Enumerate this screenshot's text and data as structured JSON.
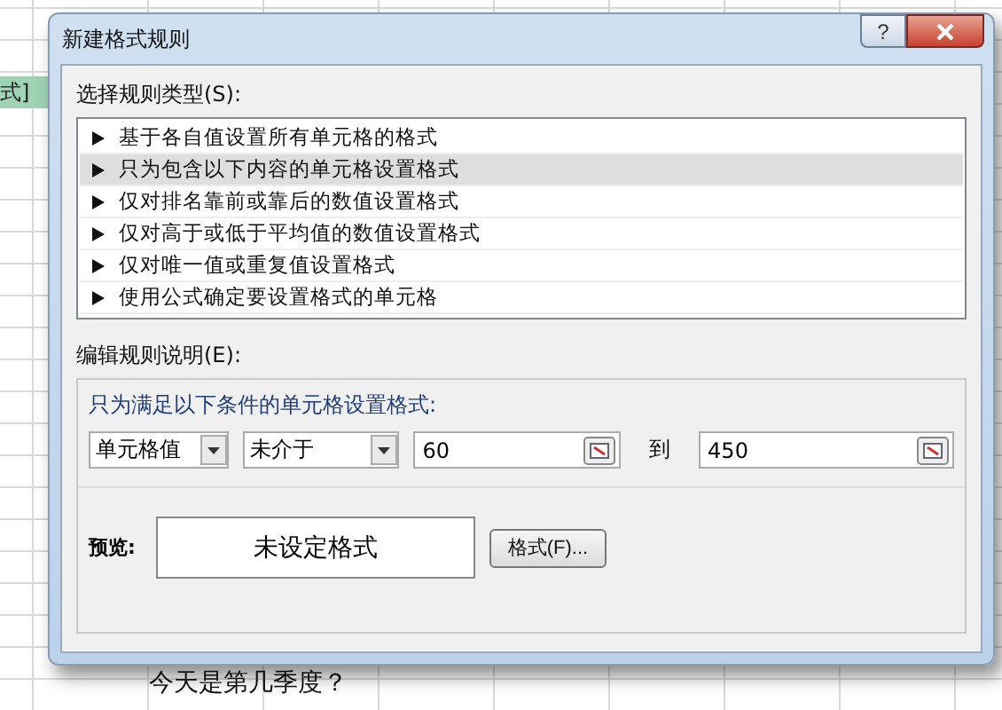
{
  "spreadsheet": {
    "cell_text": "式]",
    "bottom_text": "今天是第几季度？"
  },
  "dialog": {
    "title": "新建格式规则",
    "help_button": "?",
    "rule_type_label": "选择规则类型(S):",
    "rule_types": [
      {
        "label": "基于各自值设置所有单元格的格式",
        "selected": false
      },
      {
        "label": "只为包含以下内容的单元格设置格式",
        "selected": true
      },
      {
        "label": "仅对排名靠前或靠后的数值设置格式",
        "selected": false
      },
      {
        "label": "仅对高于或低于平均值的数值设置格式",
        "selected": false
      },
      {
        "label": "仅对唯一值或重复值设置格式",
        "selected": false
      },
      {
        "label": "使用公式确定要设置格式的单元格",
        "selected": false
      }
    ],
    "description_label": "编辑规则说明(E):",
    "condition_title": "只为满足以下条件的单元格设置格式:",
    "field_dropdown": "单元格值",
    "operator_dropdown": "未介于",
    "value_from": "60",
    "to_label": "到",
    "value_to": "450",
    "preview_label": "预览:",
    "preview_text": "未设定格式",
    "format_button": "格式(F)..."
  }
}
